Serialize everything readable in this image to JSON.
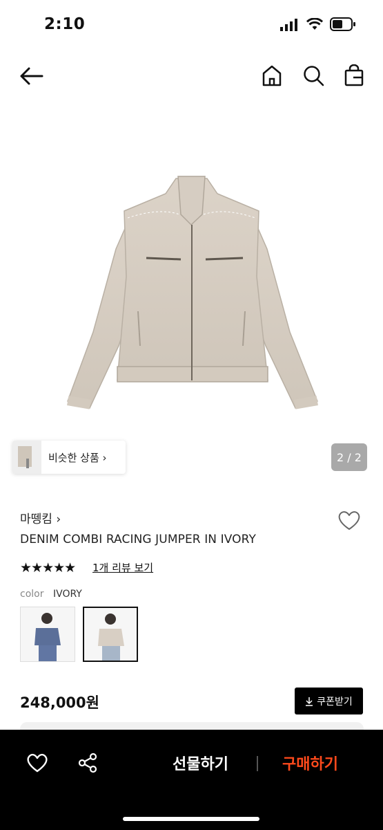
{
  "status_bar": {
    "time": "2:10"
  },
  "nav": {
    "back_icon": "arrow-left-icon",
    "home_icon": "home-icon",
    "search_icon": "search-icon",
    "cart_icon": "shopping-bag-icon"
  },
  "gallery": {
    "counter": "2 / 2",
    "similar_label": "비슷한 상품 ›"
  },
  "product": {
    "brand": "마뗑킴 ›",
    "title": "DENIM COMBI RACING JUMPER IN IVORY",
    "rating_stars": "★★★★★",
    "review_link": "1개 리뷰 보기",
    "color_label": "color",
    "color_value": "IVORY",
    "price": "248,000원",
    "coupon_label": "쿠폰받기"
  },
  "bottom_bar": {
    "gift_label": "선물하기",
    "buy_label": "구매하기",
    "accent": "#ff4a1c"
  }
}
